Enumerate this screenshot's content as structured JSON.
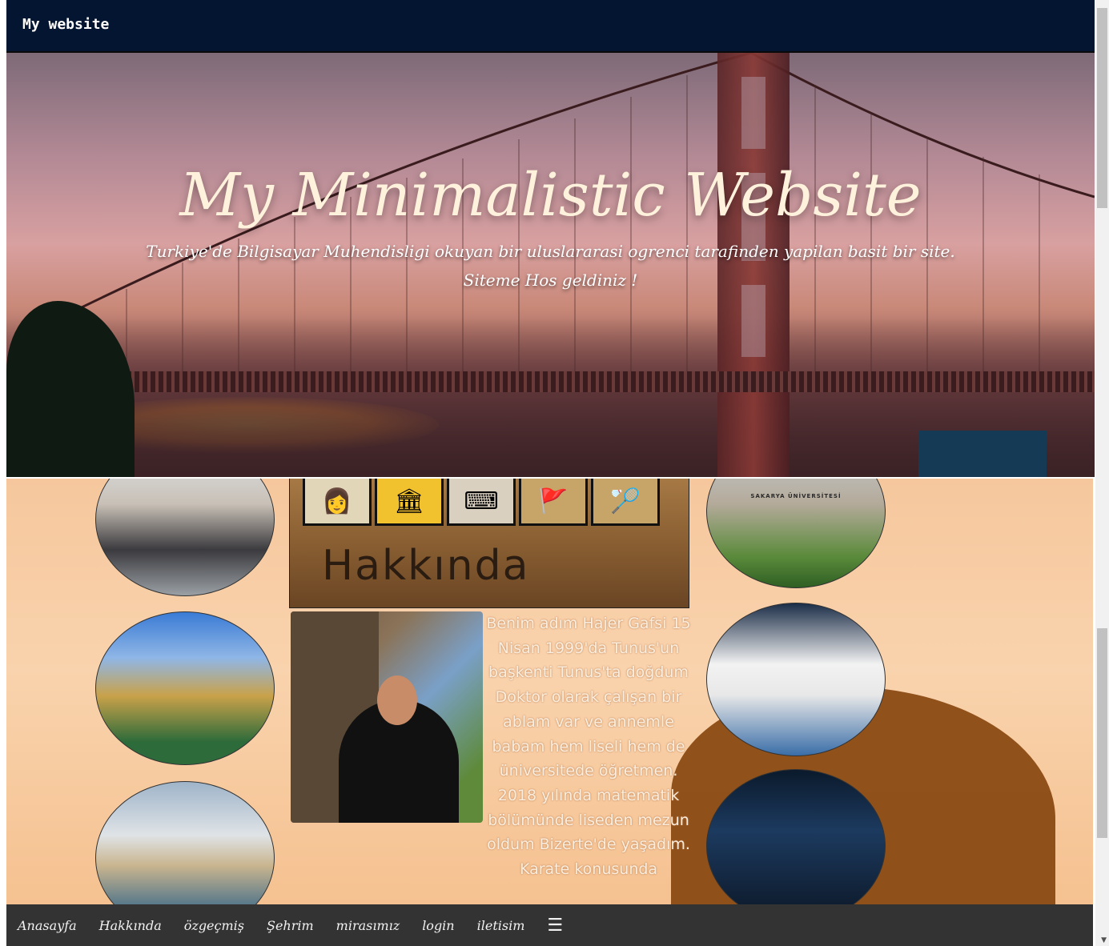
{
  "header": {
    "site_title": "My website"
  },
  "hero": {
    "title": "My Minimalistic Website",
    "subtitle_line1": "Turkiye'de Bilgisayar Muhendisligi okuyan bir uluslararasi ogrenci tarafinden yapilan basit bir site.",
    "subtitle_line2": "Siteme Hos geldiniz !"
  },
  "content": {
    "board_title": "Hakkında",
    "board_icons": [
      "👩",
      "🏛",
      "⌨",
      "🚩",
      "🏸"
    ],
    "about_text": "Benim adım Hajer Gafsi 15 Nisan 1999'da Tunus'un başkenti Tunus'ta doğdum Doktor olarak çalışan bir ablam var ve annemle babam hem liseli hem de üniversitede öğretmen. 2018 yılında matematik bölümünde liseden mezun oldum Bizerte'de yaşadım. Karate konusunda",
    "sakarya_caption": "SAKARYA ÜNİVERSİTESİ"
  },
  "nav": {
    "items": [
      "Anasayfa",
      "Hakkında",
      "özgeçmiş",
      "Şehrim",
      "mirasımız",
      "login",
      "iletisim"
    ],
    "menu_icon": "☰"
  }
}
